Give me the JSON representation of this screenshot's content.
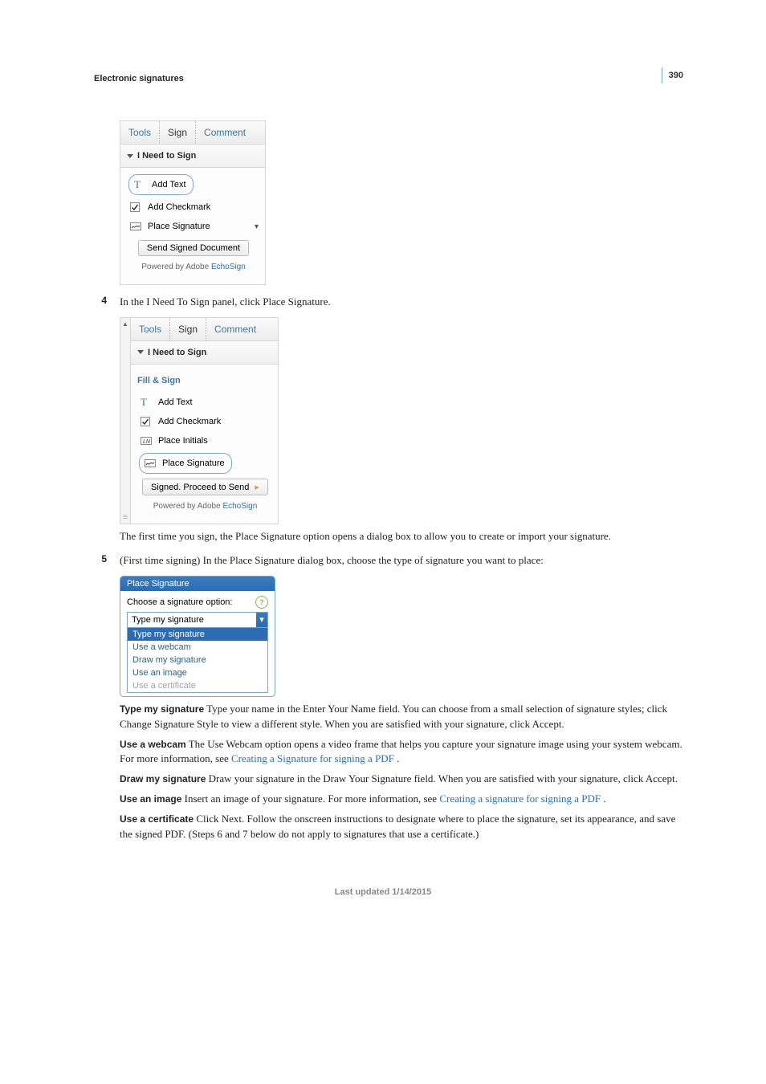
{
  "page_number": "390",
  "section_heading": "Electronic signatures",
  "panel1": {
    "tabs": [
      "Tools",
      "Sign",
      "Comment"
    ],
    "section": "I Need to Sign",
    "items": {
      "add_text": "Add Text",
      "add_check": "Add Checkmark",
      "place_sig": "Place Signature"
    },
    "button": "Send Signed Document",
    "powered_prefix": "Powered by Adobe ",
    "powered_link": "EchoSign"
  },
  "step4": {
    "num": "4",
    "text": "In the I Need To Sign panel, click Place Signature."
  },
  "panel2": {
    "tabs": [
      "Tools",
      "Sign",
      "Comment"
    ],
    "section": "I Need to Sign",
    "subhead": "Fill & Sign",
    "items": {
      "add_text": "Add Text",
      "add_check": "Add Checkmark",
      "place_initials": "Place Initials",
      "place_sig": "Place Signature"
    },
    "button": "Signed. Proceed to Send",
    "powered_prefix": "Powered by Adobe ",
    "powered_link": "EchoSign"
  },
  "after_panel2_para": "The first time you sign, the Place Signature option opens a dialog box to allow you to create or import your signature.",
  "step5": {
    "num": "5",
    "text": "(First time signing) In the Place Signature dialog box, choose the type of signature you want to place:"
  },
  "dialog": {
    "title": "Place Signature",
    "label": "Choose a signature option:",
    "value": "Type my signature",
    "options": [
      "Type my signature",
      "Use a webcam",
      "Draw my signature",
      "Use an image",
      "Use a certificate"
    ]
  },
  "runins": {
    "type_sig": {
      "head": "Type my signature",
      "body": "  Type your name in the Enter Your Name field. You can choose from a small selection of signature styles; click Change Signature Style to view a different style. When you are satisfied with your signature, click Accept."
    },
    "webcam": {
      "head": "Use a webcam",
      "body_a": "  The Use Webcam option opens a video frame that helps you capture your signature image using your system webcam. For more information, see ",
      "link": "Creating a Signature for signing a PDF ",
      "body_b": "."
    },
    "draw": {
      "head": "Draw my signature",
      "body": "  Draw your signature in the Draw Your Signature field. When you are satisfied with your signature, click Accept."
    },
    "image": {
      "head": "Use an image",
      "body_a": "  Insert an image of your signature. For more information, see ",
      "link": "Creating a signature for signing a PDF ",
      "body_b": "."
    },
    "cert": {
      "head": "Use a certificate",
      "body": "  Click Next. Follow the onscreen instructions to designate where to place the signature, set its appearance, and save the signed PDF. (Steps 6 and 7 below do not apply to signatures that use a certificate.)"
    }
  },
  "footer": "Last updated 1/14/2015"
}
